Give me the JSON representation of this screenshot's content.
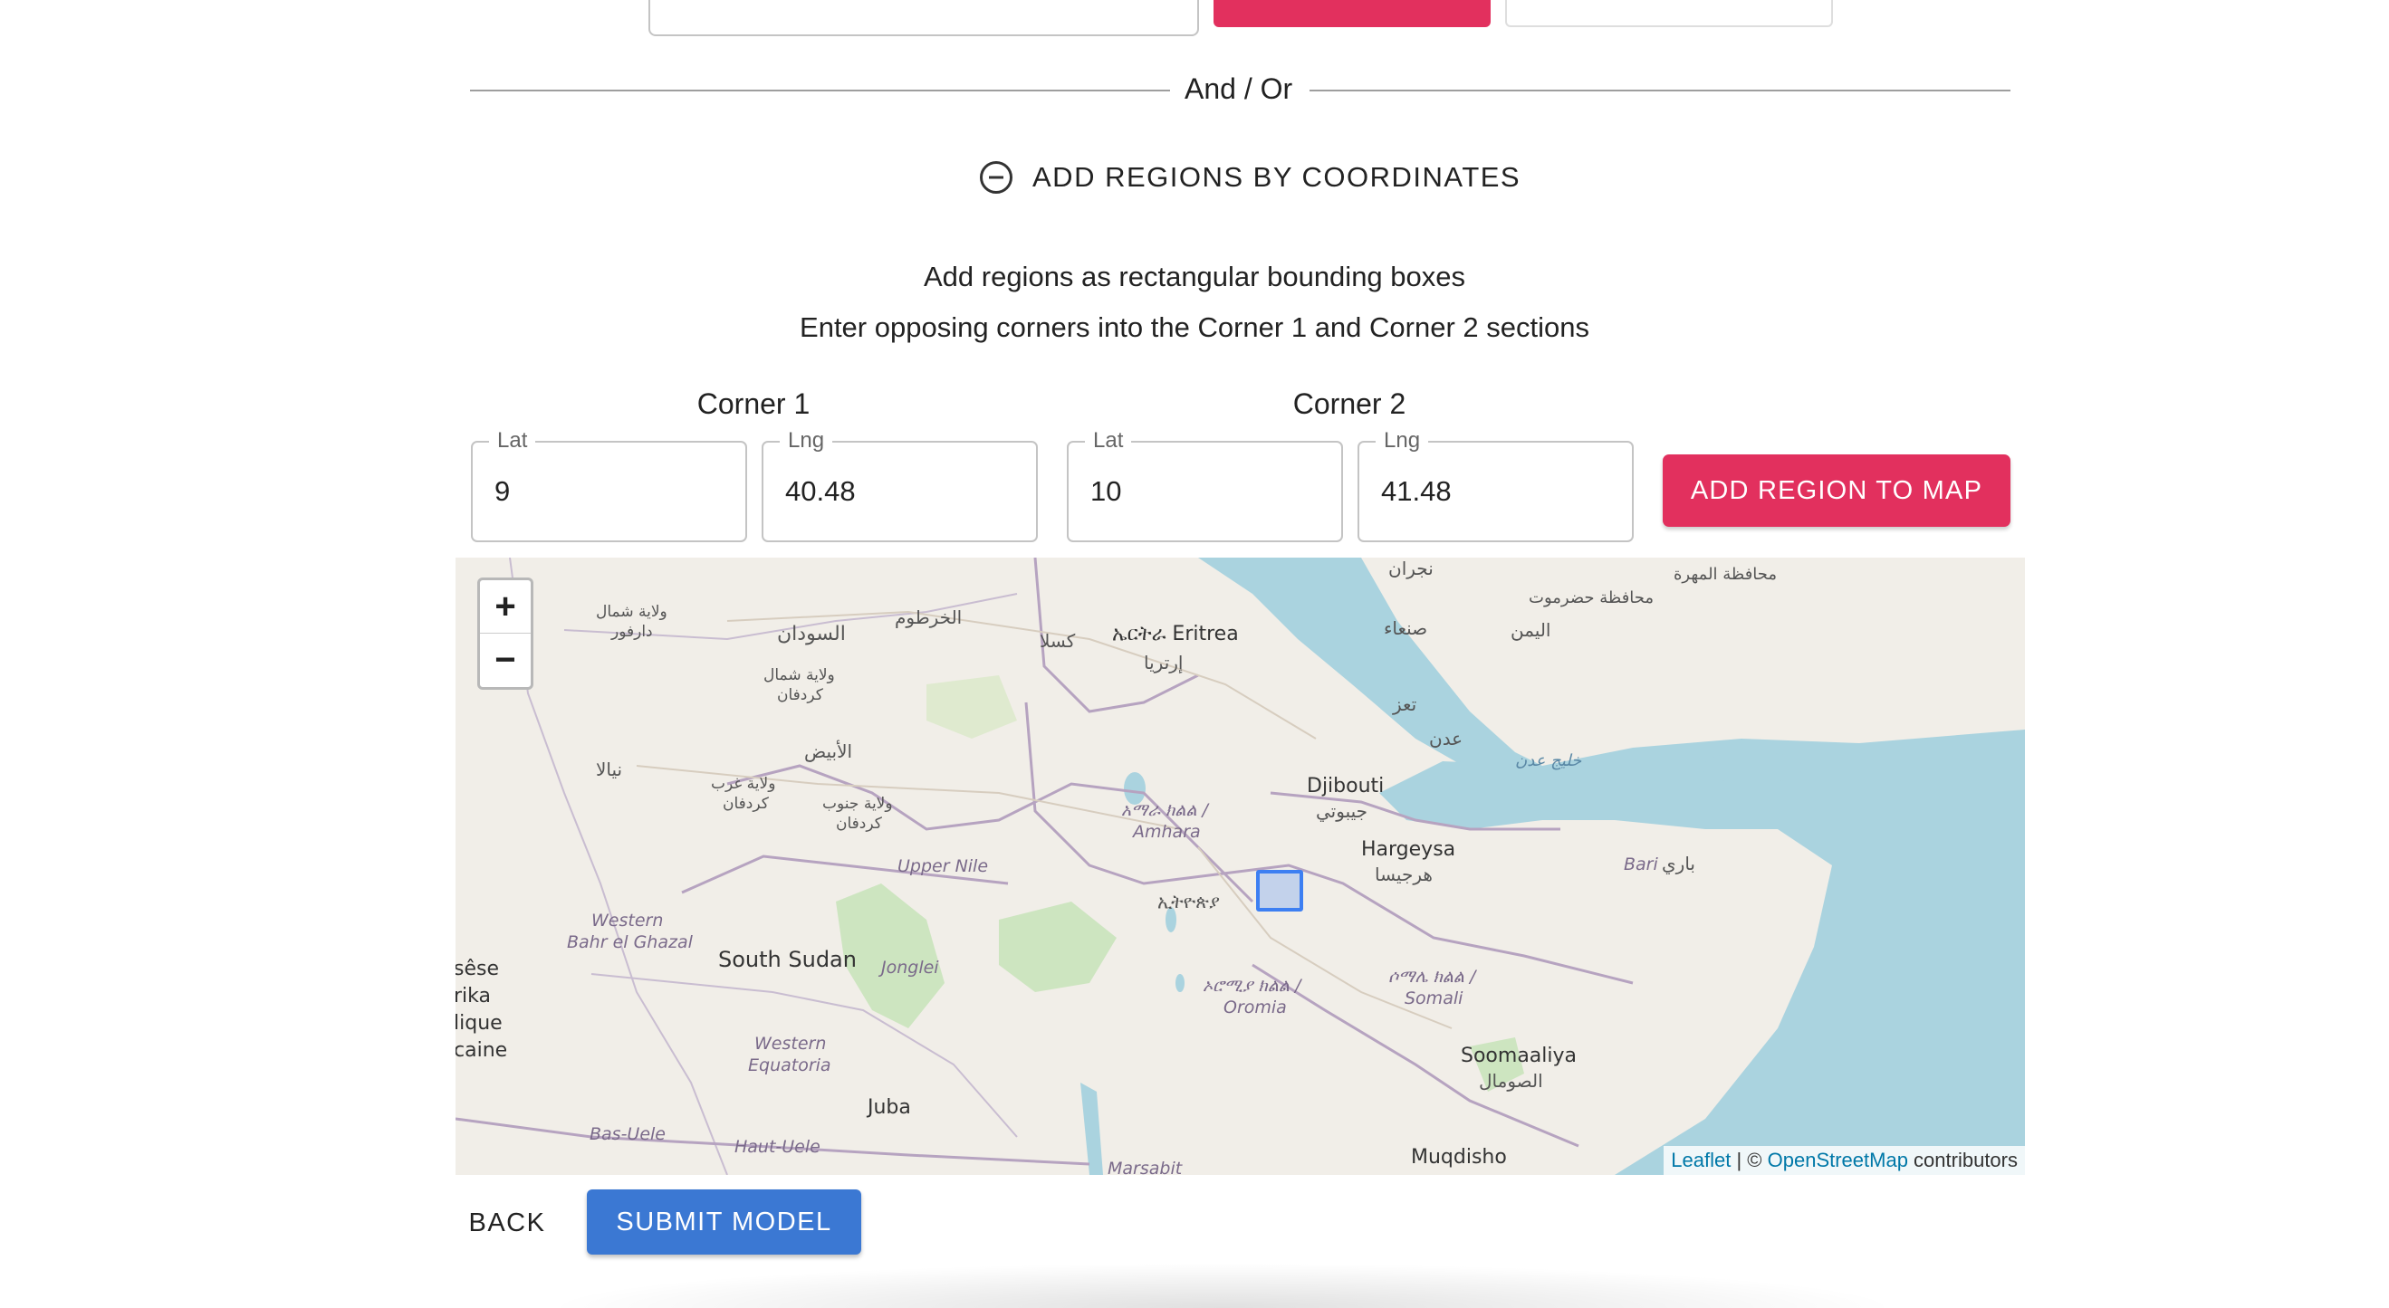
{
  "divider": {
    "text": "And / Or"
  },
  "coordinates_toggle": {
    "label": "ADD REGIONS BY COORDINATES",
    "icon": "minus-circle-icon"
  },
  "instructions": {
    "line1": "Add regions as rectangular bounding boxes",
    "line2": "Enter opposing corners into the Corner 1 and Corner 2 sections"
  },
  "corner1": {
    "title": "Corner 1",
    "lat": {
      "label": "Lat",
      "value": "9"
    },
    "lng": {
      "label": "Lng",
      "value": "40.48"
    }
  },
  "corner2": {
    "title": "Corner 2",
    "lat": {
      "label": "Lat",
      "value": "10"
    },
    "lng": {
      "label": "Lng",
      "value": "41.48"
    }
  },
  "add_region_button": {
    "label": "ADD REGION TO MAP",
    "color": "#e2305e"
  },
  "map": {
    "zoom_in": "+",
    "zoom_out": "−",
    "labels": {
      "eritrea": "ኤርትራ Eritrea",
      "eritrea_ar": "إرتريا",
      "djibouti": "Djibouti",
      "djibouti_ar": "جيبوتي",
      "hargeysa": "Hargeysa",
      "hargeysa_ar": "هرجيسا",
      "south_sudan": "South Sudan",
      "juba": "Juba",
      "somalia": "Soomaaliya",
      "somalia_ar": "الصومال",
      "muqdisho": "Muqdisho",
      "ethiopia": "ኢትዮጵያ",
      "amhara": "አማራ ክልል /",
      "amhara2": "Amhara",
      "oromia": "ኦሮሚያ ክልል /",
      "oromia2": "Oromia",
      "somali": "ሶማሌ ክልል /",
      "somali2": "Somali",
      "upper_nile": "Upper Nile",
      "jonglei": "Jonglei",
      "western_equatoria": "Western",
      "western_equatoria2": "Equatoria",
      "western_bahr": "Western",
      "western_bahr2": "Bahr el Ghazal",
      "bas_uele": "Bas-Uele",
      "haut_uele": "Haut-Uele",
      "marsabit": "Marsabit",
      "bari": "Bari",
      "bari_ar": "باري",
      "sudan_ar": "السودان",
      "khartoum_ar": "الخرطوم",
      "kassala_ar": "كسلا",
      "sanaa_ar": "صنعاء",
      "yemen_ar": "اليمن",
      "taiz_ar": "تعز",
      "aden_ar": "عدن",
      "najran_ar": "نجران",
      "mahra_ar": "محافظة المهرة",
      "hadramaut_ar": "محافظة حضرموت",
      "gulf_aden_ar": "خليج عدن",
      "obeid_ar": "الأبيض",
      "nyala_ar": "نيالا",
      "north_darfur_ar": "ولاية شمال",
      "north_darfur2_ar": "دارفور",
      "north_kordofan_ar": "ولاية شمال",
      "north_kordofan2_ar": "كردفان",
      "west_kordofan_ar": "ولاية غرب",
      "west_kordofan2_ar": "كردفان",
      "south_kordofan_ar": "ولاية جنوب",
      "south_kordofan2_ar": "كردفان",
      "edge1": "sêse",
      "edge2": "rika",
      "edge3": "lique",
      "edge4": "caine"
    },
    "region_box_color": "#3d7ff2",
    "attribution": {
      "leaflet": "Leaflet",
      "separator": " | © ",
      "osm": "OpenStreetMap",
      "contributors": " contributors"
    }
  },
  "footer": {
    "back_label": "BACK",
    "submit_label": "SUBMIT MODEL",
    "submit_color": "#3b78d3"
  }
}
